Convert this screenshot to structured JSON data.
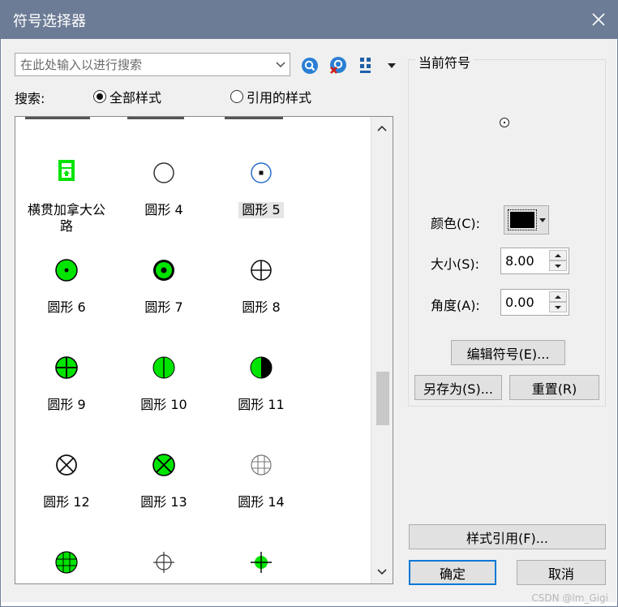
{
  "window": {
    "title": "符号选择器"
  },
  "search": {
    "placeholder": "在此处输入以进行搜索",
    "value": ""
  },
  "search_scope": {
    "label": "搜索:",
    "options": [
      {
        "label": "全部样式",
        "selected": true
      },
      {
        "label": "引用的样式",
        "selected": false
      }
    ]
  },
  "icons": {
    "search": "search-icon",
    "clear": "clear-search-icon",
    "view": "grid-view-icon"
  },
  "gallery": {
    "items": [
      {
        "name": "横贯加拿大公路",
        "symbol": "trans-canada-highway"
      },
      {
        "name": "圆形 4",
        "symbol": "circle-hollow"
      },
      {
        "name": "圆形 5",
        "symbol": "circle-blue-dot",
        "selected": true
      },
      {
        "name": "圆形 6",
        "symbol": "circle-green-dot"
      },
      {
        "name": "圆形 7",
        "symbol": "circle-green-ring-dot"
      },
      {
        "name": "圆形 8",
        "symbol": "circle-cross"
      },
      {
        "name": "圆形 9",
        "symbol": "circle-green-cross"
      },
      {
        "name": "圆形 10",
        "symbol": "circle-green-vline"
      },
      {
        "name": "圆形 11",
        "symbol": "circle-half"
      },
      {
        "name": "圆形 12",
        "symbol": "circle-x"
      },
      {
        "name": "圆形 13",
        "symbol": "circle-green-x"
      },
      {
        "name": "圆形 14",
        "symbol": "circle-grid"
      },
      {
        "name": "",
        "symbol": "circle-green-grid"
      },
      {
        "name": "",
        "symbol": "crosshair"
      },
      {
        "name": "",
        "symbol": "circle-green-crosshair"
      }
    ]
  },
  "current_symbol": {
    "title": "当前符号",
    "color_label": "颜色(C):",
    "color": "#000000",
    "size_label": "大小(S):",
    "size": "8.00",
    "angle_label": "角度(A):",
    "angle": "0.00",
    "edit_button": "编辑符号(E)...",
    "save_as_button": "另存为(S)...",
    "reset_button": "重置(R)"
  },
  "style_references_button": "样式引用(F)...",
  "ok_button": "确定",
  "cancel_button": "取消",
  "watermark": "CSDN @lm_Gigi",
  "colors": {
    "titlebar": "#6c7c96",
    "symbol_green": "#00e400",
    "accent": "#0078d7"
  }
}
